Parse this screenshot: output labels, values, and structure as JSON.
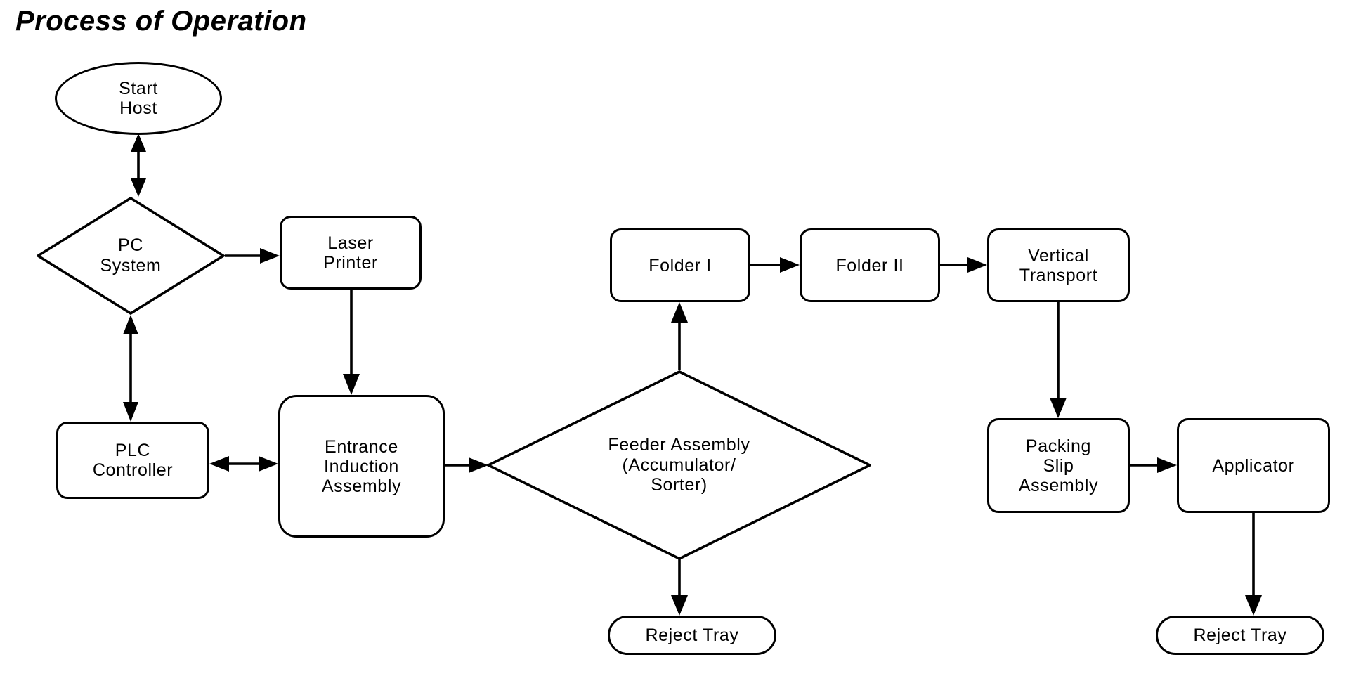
{
  "title": "Process of Operation",
  "theme": {
    "background": "#ffffff",
    "stroke": "#000000",
    "text": "#000000"
  },
  "nodes": {
    "start_host": {
      "label": "Start\nHost",
      "shape": "ellipse"
    },
    "pc_system": {
      "label": "PC\nSystem",
      "shape": "diamond"
    },
    "laser_printer": {
      "label": "Laser\nPrinter",
      "shape": "rounded-rect"
    },
    "plc_controller": {
      "label": "PLC\nController",
      "shape": "rounded-rect"
    },
    "entrance_induction_assembly": {
      "label": "Entrance\nInduction\nAssembly",
      "shape": "rounded-rect"
    },
    "feeder_assembly": {
      "label": "Feeder Assembly\n(Accumulator/\nSorter)",
      "shape": "diamond"
    },
    "folder_i": {
      "label": "Folder I",
      "shape": "rounded-rect"
    },
    "folder_ii": {
      "label": "Folder II",
      "shape": "rounded-rect"
    },
    "vertical_transport": {
      "label": "Vertical\nTransport",
      "shape": "rounded-rect"
    },
    "packing_slip_assembly": {
      "label": "Packing\nSlip\nAssembly",
      "shape": "rounded-rect"
    },
    "applicator": {
      "label": "Applicator",
      "shape": "rounded-rect"
    },
    "reject_tray_feeder": {
      "label": "Reject Tray",
      "shape": "stadium"
    },
    "reject_tray_applicator": {
      "label": "Reject Tray",
      "shape": "stadium"
    }
  },
  "edges": [
    {
      "from": "pc_system",
      "to": "start_host",
      "direction": "bidirectional"
    },
    {
      "from": "pc_system",
      "to": "laser_printer",
      "direction": "forward"
    },
    {
      "from": "pc_system",
      "to": "plc_controller",
      "direction": "bidirectional"
    },
    {
      "from": "laser_printer",
      "to": "entrance_induction_assembly",
      "direction": "forward"
    },
    {
      "from": "plc_controller",
      "to": "entrance_induction_assembly",
      "direction": "bidirectional"
    },
    {
      "from": "entrance_induction_assembly",
      "to": "feeder_assembly",
      "direction": "forward"
    },
    {
      "from": "feeder_assembly",
      "to": "folder_i",
      "direction": "forward"
    },
    {
      "from": "feeder_assembly",
      "to": "reject_tray_feeder",
      "direction": "forward"
    },
    {
      "from": "folder_i",
      "to": "folder_ii",
      "direction": "forward"
    },
    {
      "from": "folder_ii",
      "to": "vertical_transport",
      "direction": "forward"
    },
    {
      "from": "vertical_transport",
      "to": "packing_slip_assembly",
      "direction": "forward"
    },
    {
      "from": "packing_slip_assembly",
      "to": "applicator",
      "direction": "forward"
    },
    {
      "from": "applicator",
      "to": "reject_tray_applicator",
      "direction": "forward"
    }
  ]
}
